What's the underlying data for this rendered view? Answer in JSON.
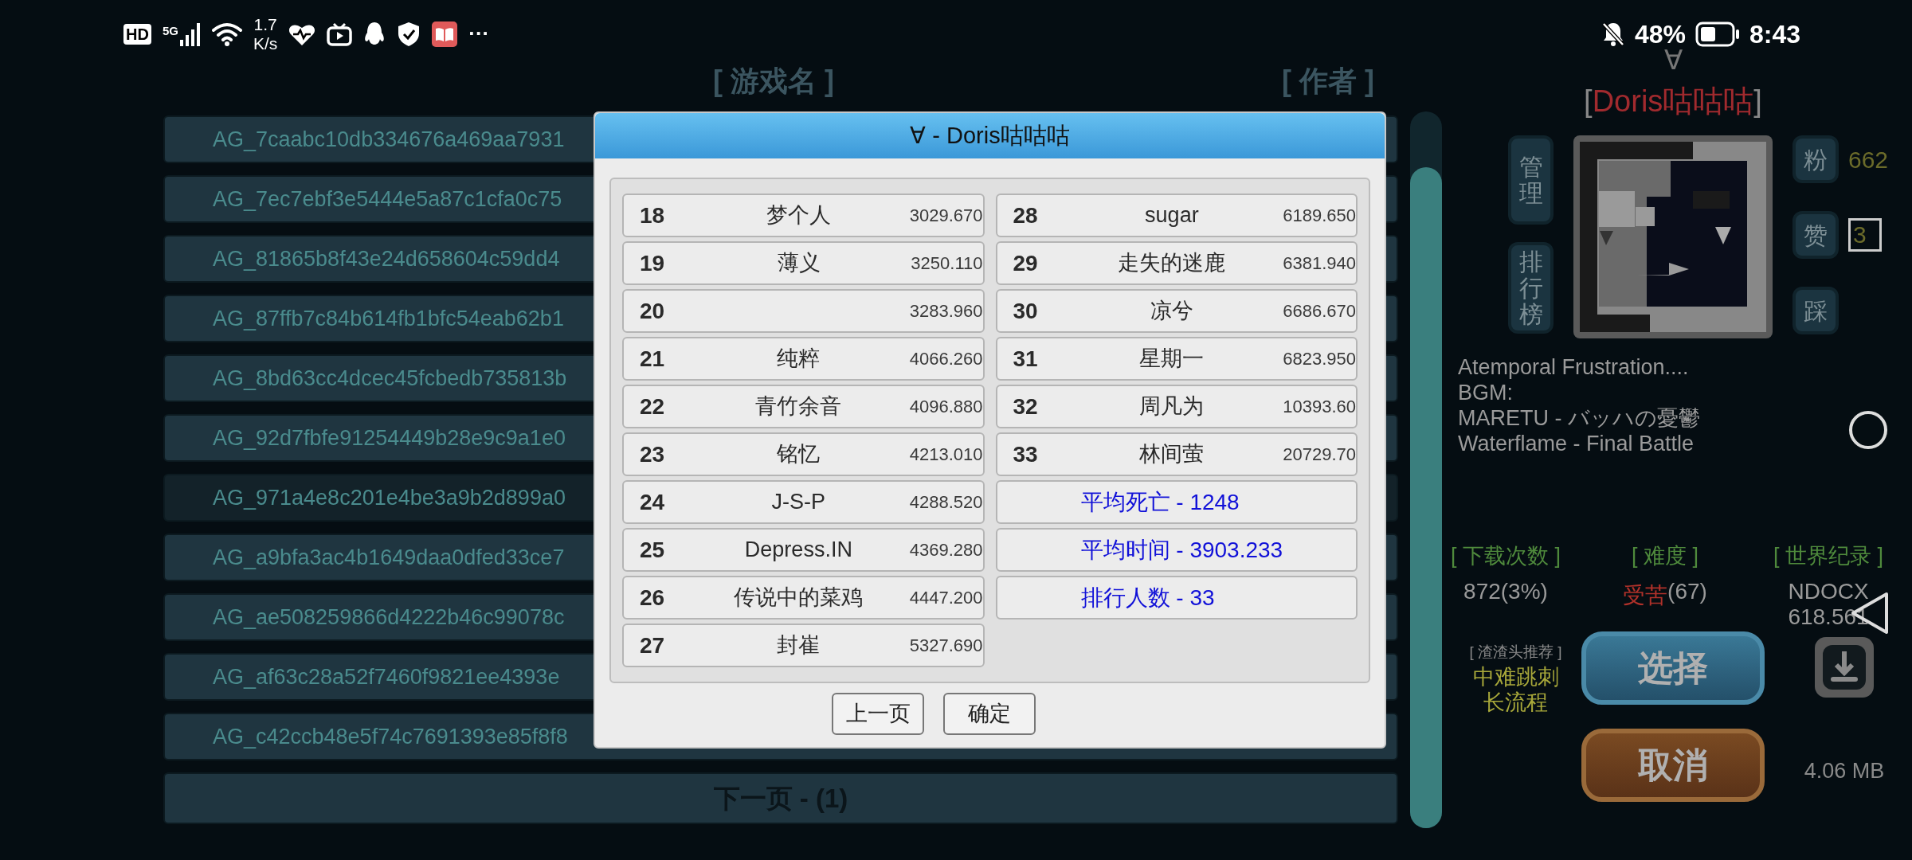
{
  "status_bar": {
    "hd": "HD",
    "network": "5G",
    "speed": [
      "1.7",
      "K/s"
    ],
    "more": "···",
    "battery": "48%",
    "time": "8:43"
  },
  "game_list": {
    "headers": [
      "[ 游戏名 ]",
      "[ 作者 ]"
    ],
    "rows": [
      {
        "name": "AG_7caabc10db334676a469aa7931",
        "selected": false
      },
      {
        "name": "AG_7ec7ebf3e5444e5a87c1cfa0c75",
        "selected": false
      },
      {
        "name": "AG_81865b8f43e24d658604c59dd4",
        "selected": false
      },
      {
        "name": "AG_87ffb7c84b614fb1bfc54eab62b1",
        "selected": false
      },
      {
        "name": "AG_8bd63cc4dcec45fcbedb735813b",
        "selected": false
      },
      {
        "name": "AG_92d7fbfe91254449b28e9c9a1e0",
        "selected": false
      },
      {
        "name": "AG_971a4e8c201e4be3a9b2d899a0",
        "selected": true
      },
      {
        "name": "AG_a9bfa3ac4b1649daa0dfed33ce7",
        "selected": false
      },
      {
        "name": "AG_ae508259866d4222b46c99078c",
        "selected": false
      },
      {
        "name": "AG_af63c28a52f7460f9821ee4393e",
        "selected": false
      },
      {
        "name": "AG_c42ccb48e5f74c7691393e85f8f8",
        "selected": false
      }
    ],
    "next_page": "下一页 - (1)"
  },
  "dialog": {
    "title": "∀ - Doris咕咕咕",
    "left_column": [
      {
        "kind": "rank",
        "rank": "18",
        "name": "梦个人",
        "time": "3029.670"
      },
      {
        "kind": "rank",
        "rank": "19",
        "name": "薄义",
        "time": "3250.110"
      },
      {
        "kind": "rank",
        "rank": "20",
        "time": "3283.960"
      },
      {
        "kind": "rank",
        "rank": "21",
        "name": "纯粹",
        "time": "4066.260"
      },
      {
        "kind": "rank",
        "rank": "22",
        "name": "青竹余音",
        "time": "4096.880"
      },
      {
        "kind": "rank",
        "rank": "23",
        "name": "铭忆",
        "time": "4213.010"
      },
      {
        "kind": "rank",
        "rank": "24",
        "name": "J-S-P",
        "time": "4288.520"
      },
      {
        "kind": "rank",
        "rank": "25",
        "name": "Depress.IN",
        "time": "4369.280"
      },
      {
        "kind": "rank",
        "rank": "26",
        "name": "传说中的菜鸡",
        "time": "4447.200"
      },
      {
        "kind": "rank",
        "rank": "27",
        "name": "封崔",
        "time": "5327.690"
      }
    ],
    "right_column": [
      {
        "kind": "rank",
        "rank": "28",
        "name": "sugar",
        "time": "6189.650"
      },
      {
        "kind": "rank",
        "rank": "29",
        "name": "走失的迷鹿",
        "time": "6381.940"
      },
      {
        "kind": "rank",
        "rank": "30",
        "name": "凉兮",
        "time": "6686.670"
      },
      {
        "kind": "rank",
        "rank": "31",
        "name": "星期一",
        "time": "6823.950"
      },
      {
        "kind": "rank",
        "rank": "32",
        "name": "周凡为",
        "time": "10393.60"
      },
      {
        "kind": "rank",
        "rank": "33",
        "name": "林间萤",
        "time": "20729.70"
      },
      {
        "kind": "stat",
        "text": "平均死亡 - 1248"
      },
      {
        "kind": "stat",
        "text": "平均时间 - 3903.233"
      },
      {
        "kind": "stat",
        "text": "排行人数 - 33"
      }
    ],
    "buttons": [
      "上一页",
      "确定"
    ]
  },
  "detail": {
    "symbol": "∀",
    "author_brackets": [
      "[",
      "]"
    ],
    "author": "Doris咕咕咕",
    "side_buttons": [
      "管理",
      "排行榜"
    ],
    "reactions": [
      {
        "label": "粉",
        "count": "662",
        "boxed": false
      },
      {
        "label": "赞",
        "count": "3",
        "boxed": true
      },
      {
        "label": "踩"
      }
    ],
    "description": [
      "Atemporal Frustration....",
      "BGM:",
      "MARETU - バッハの憂鬱",
      "Waterflame - Final Battle"
    ],
    "stats": [
      {
        "label": "[ 下载次数 ]",
        "value": [
          "872(3%)"
        ]
      },
      {
        "label": "[ 难度 ]",
        "highlight": "受苦",
        "value": [
          "(67)"
        ]
      },
      {
        "label": "[ 世界纪录 ]",
        "value": [
          "NDOCX",
          "618.561"
        ]
      }
    ],
    "recommend": {
      "label": "[ 渣渣头推荐 ]",
      "text": [
        "中难跳刺",
        "长流程"
      ]
    },
    "select": "选择",
    "cancel": "取消",
    "size": "4.06 MB"
  }
}
